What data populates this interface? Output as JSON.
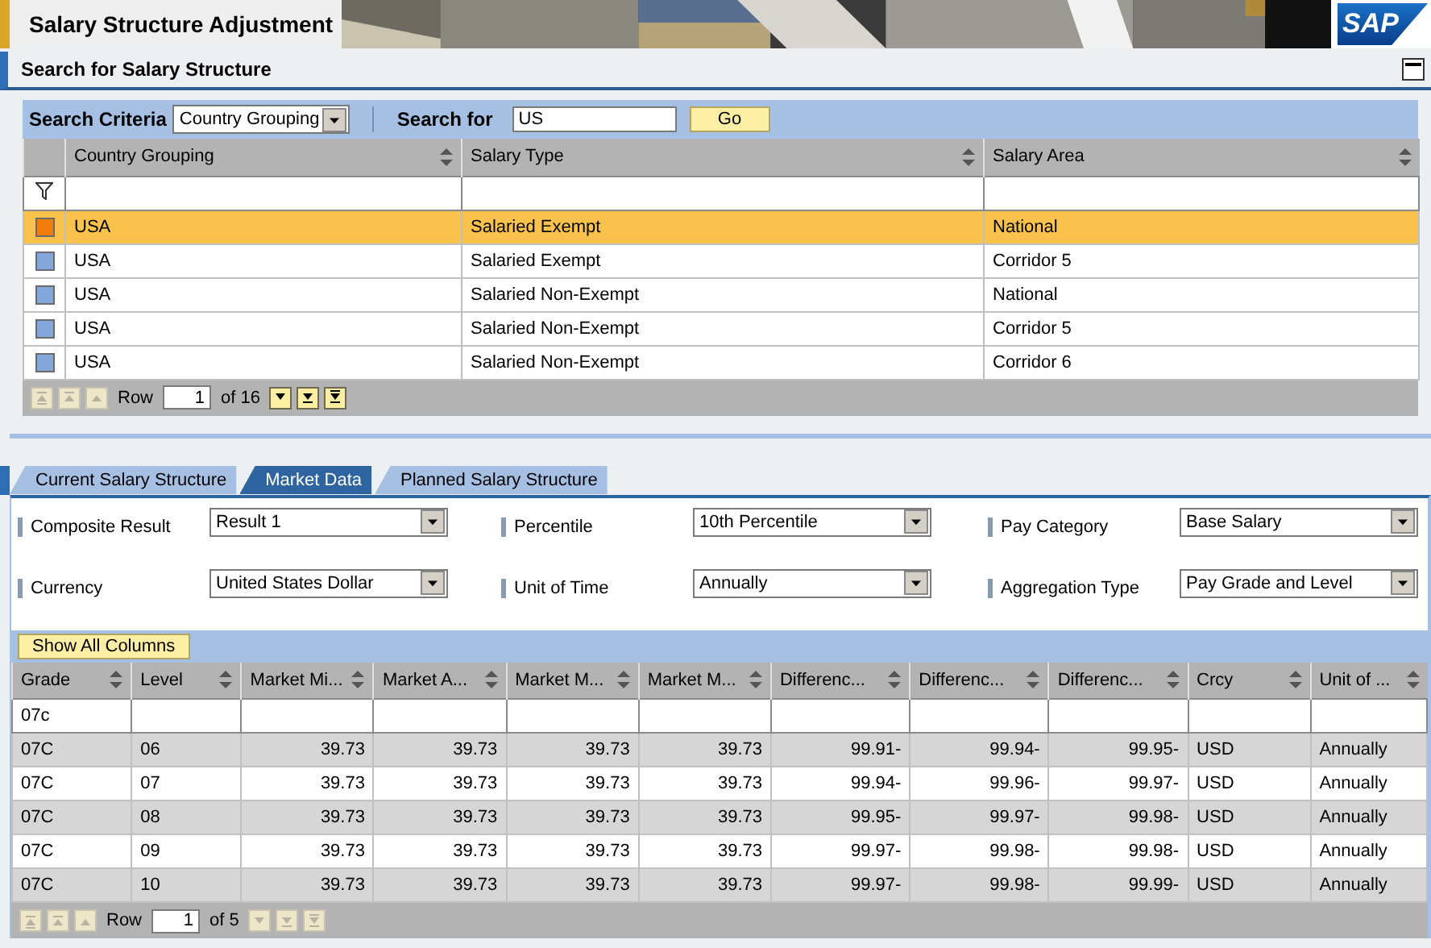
{
  "header": {
    "title": "Salary Structure Adjustment",
    "logo": "SAP"
  },
  "section": {
    "title": "Search for Salary Structure"
  },
  "search": {
    "criteria_label": "Search Criteria",
    "criteria_value": "Country Grouping",
    "search_label": "Search for",
    "search_value": "US",
    "go_button": "Go"
  },
  "search_results": {
    "columns": [
      {
        "label": "Country Grouping"
      },
      {
        "label": "Salary Type"
      },
      {
        "label": "Salary Area"
      }
    ],
    "rows": [
      {
        "selected": true,
        "cells": [
          "USA",
          "Salaried Exempt",
          "National"
        ]
      },
      {
        "selected": false,
        "cells": [
          "USA",
          "Salaried Exempt",
          "Corridor 5"
        ]
      },
      {
        "selected": false,
        "cells": [
          "USA",
          "Salaried Non-Exempt",
          "National"
        ]
      },
      {
        "selected": false,
        "cells": [
          "USA",
          "Salaried Non-Exempt",
          "Corridor 5"
        ]
      },
      {
        "selected": false,
        "cells": [
          "USA",
          "Salaried Non-Exempt",
          "Corridor 6"
        ]
      }
    ],
    "pager": {
      "label": "Row",
      "value": "1",
      "total": "of 16",
      "buttons": [
        {
          "kind": "first",
          "disabled": true
        },
        {
          "kind": "page-up",
          "disabled": true
        },
        {
          "kind": "up",
          "disabled": true
        },
        {
          "kind": "down",
          "disabled": false
        },
        {
          "kind": "page-down",
          "disabled": false
        },
        {
          "kind": "last",
          "disabled": false
        }
      ]
    }
  },
  "tabs": [
    {
      "label": "Current Salary Structure",
      "selected": false
    },
    {
      "label": "Market Data",
      "selected": true
    },
    {
      "label": "Planned Salary Structure",
      "selected": false
    }
  ],
  "filters": [
    {
      "label": "Composite Result",
      "value": "Result 1"
    },
    {
      "label": "Percentile",
      "value": "10th Percentile"
    },
    {
      "label": "Pay Category",
      "value": "Base Salary"
    },
    {
      "label": "Currency",
      "value": "United States Dollar"
    },
    {
      "label": "Unit of Time",
      "value": "Annually"
    },
    {
      "label": "Aggregation Type",
      "value": "Pay Grade and Level"
    }
  ],
  "market_table": {
    "toolbar_button": "Show All Columns",
    "columns": [
      {
        "label": "Grade",
        "numeric": false,
        "filter": "07c"
      },
      {
        "label": "Level",
        "numeric": false
      },
      {
        "label": "Market Mi...",
        "numeric": true
      },
      {
        "label": "Market A...",
        "numeric": true
      },
      {
        "label": "Market M...",
        "numeric": true
      },
      {
        "label": "Market M...",
        "numeric": true
      },
      {
        "label": "Differenc...",
        "numeric": true
      },
      {
        "label": "Differenc...",
        "numeric": true
      },
      {
        "label": "Differenc...",
        "numeric": true
      },
      {
        "label": "Crcy",
        "numeric": false
      },
      {
        "label": "Unit of ...",
        "numeric": false
      }
    ],
    "rows": [
      {
        "cells": [
          "07C",
          "06",
          "39.73",
          "39.73",
          "39.73",
          "39.73",
          "99.91-",
          "99.94-",
          "99.95-",
          "USD",
          "Annually"
        ]
      },
      {
        "cells": [
          "07C",
          "07",
          "39.73",
          "39.73",
          "39.73",
          "39.73",
          "99.94-",
          "99.96-",
          "99.97-",
          "USD",
          "Annually"
        ]
      },
      {
        "cells": [
          "07C",
          "08",
          "39.73",
          "39.73",
          "39.73",
          "39.73",
          "99.95-",
          "99.97-",
          "99.98-",
          "USD",
          "Annually"
        ]
      },
      {
        "cells": [
          "07C",
          "09",
          "39.73",
          "39.73",
          "39.73",
          "39.73",
          "99.97-",
          "99.98-",
          "99.98-",
          "USD",
          "Annually"
        ]
      },
      {
        "cells": [
          "07C",
          "10",
          "39.73",
          "39.73",
          "39.73",
          "39.73",
          "99.97-",
          "99.98-",
          "99.99-",
          "USD",
          "Annually"
        ]
      }
    ],
    "pager": {
      "label": "Row",
      "value": "1",
      "total": "of 5",
      "buttons": [
        {
          "kind": "first",
          "disabled": true
        },
        {
          "kind": "page-up",
          "disabled": true
        },
        {
          "kind": "up",
          "disabled": true
        },
        {
          "kind": "down",
          "disabled": true
        },
        {
          "kind": "page-down",
          "disabled": true
        },
        {
          "kind": "last",
          "disabled": true
        }
      ]
    }
  }
}
